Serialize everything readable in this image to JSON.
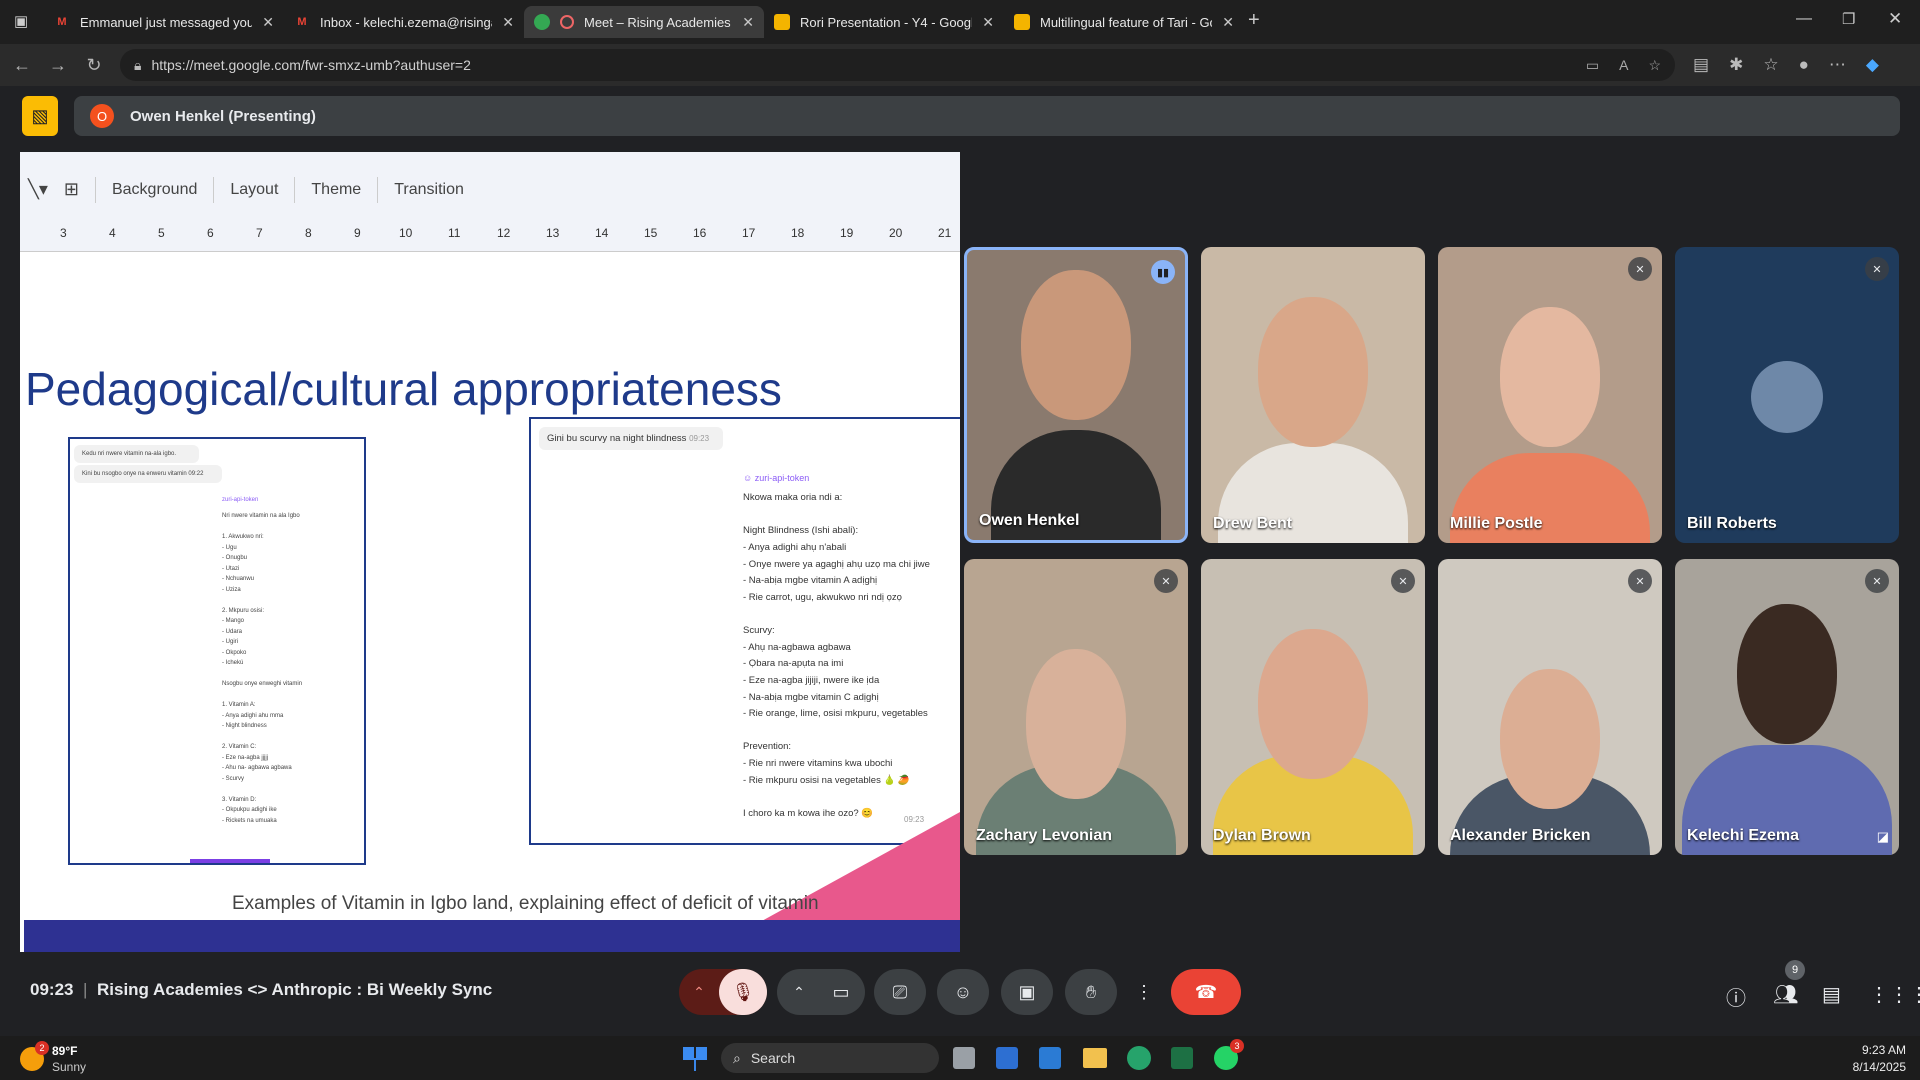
{
  "browser": {
    "tabs": [
      {
        "title": "Emmanuel just messaged you - k",
        "icon": "gmail-icon"
      },
      {
        "title": "Inbox - kelechi.ezema@risingacad",
        "icon": "gmail-icon"
      },
      {
        "title": "Meet – Rising Academies <>",
        "icon": "meet-icon",
        "active": true
      },
      {
        "title": "Rori Presentation - Y4 - Google Sl",
        "icon": "slides-icon"
      },
      {
        "title": "Multilingual feature of Tari - Goo",
        "icon": "slides-icon"
      }
    ],
    "url": "https://meet.google.com/fwr-smxz-umb?authuser=2"
  },
  "meet": {
    "presenter_initial": "O",
    "presenter_label": "Owen Henkel (Presenting)",
    "meeting_time": "09:23",
    "meeting_title": "Rising Academies <> Anthropic : Bi Weekly Sync",
    "participant_count": "9",
    "participants": [
      {
        "name": "Owen Henkel",
        "mic": "speaking"
      },
      {
        "name": "Drew Bent",
        "mic": "on"
      },
      {
        "name": "Millie Postle",
        "mic": "muted"
      },
      {
        "name": "Bill Roberts",
        "mic": "muted"
      },
      {
        "name": "Zachary Levonian",
        "mic": "muted"
      },
      {
        "name": "Dylan Brown",
        "mic": "muted"
      },
      {
        "name": "Alexander Bricken",
        "mic": "muted"
      },
      {
        "name": "Kelechi Ezema",
        "mic": "muted"
      }
    ]
  },
  "slides": {
    "toolbar": [
      "Background",
      "Layout",
      "Theme",
      "Transition"
    ],
    "ruler": [
      "3",
      "4",
      "5",
      "6",
      "7",
      "8",
      "9",
      "10",
      "11",
      "12",
      "13",
      "14",
      "15",
      "16",
      "17",
      "18",
      "19",
      "20",
      "21"
    ],
    "title": "Pedagogical/cultural appropriateness",
    "caption": "Examples of Vitamin in Igbo land, explaining effect of deficit of vitamin",
    "phone1": {
      "q1": "Kedu nri nwere vitamin na-ala igbo.",
      "q2": "Kini bu nsogbo onye na enweru vitamin",
      "q2_time": "09:22",
      "bot": "zuri-api-token",
      "lines": [
        "Nri nwere vitamin na ala Igbo",
        "",
        "1. Akwukwo nri:",
        "- Ugu",
        "- Onugbu",
        "- Utazi",
        "- Nchuanwu",
        "- Uziza",
        "",
        "2. Mkpuru osisi:",
        "- Mango",
        "- Udara",
        "- Ugiri",
        "- Okpoko",
        "- Ichekú",
        "",
        "Nsogbu onye enweghi vitamin",
        "",
        "1. Vitamin A:",
        "- Anya adighi ahu mma",
        "- Night blindness",
        "",
        "2. Vitamin C:",
        "- Eze na-agba jjjjj",
        "- Ahu na- agbawa agbawa",
        "- Scurvy",
        "",
        "3. Vitamin D:",
        "- Okpukpu adighi ike",
        "- Rickets na umuaka"
      ]
    },
    "phone2": {
      "q": "Gini bu scurvy na night blindness",
      "q_time": "09:23",
      "bot": "zuri-api-token",
      "lines": [
        "Nkowa maka oria ndi a:",
        "",
        "Night Blindness (Ishi abali):",
        "- Anya adighi ahụ n'abali",
        "- Onye nwere ya agaghị ahụ uzọ ma chi jiwe",
        "- Na-abịa mgbe vitamin A adịghị",
        "- Rie carrot, ugu, akwukwo nri ndị ọzọ",
        "",
        "Scurvy:",
        "- Ahụ na-agbawa agbawa",
        "- Ọbara na-apụta na imi",
        "- Eze na-agba jijiji, nwere ike ịda",
        "- Na-abịa mgbe vitamin C adịghị",
        "- Rie orange, lime, osisi mkpuru, vegetables",
        "",
        "Prevention:",
        "- Rie nri nwere vitamins kwa ubochi",
        "- Rie mkpuru osisi na vegetables 🍐 🥭",
        "",
        "I choro ka m kowa ihe ozo? 😊"
      ],
      "last_time": "09:23"
    }
  },
  "taskbar": {
    "temp": "89°F",
    "weather": "Sunny",
    "weather_badge": "2",
    "search": "Search",
    "whatsapp_badge": "3",
    "time": "9:23 AM",
    "date": "8/14/2025"
  }
}
